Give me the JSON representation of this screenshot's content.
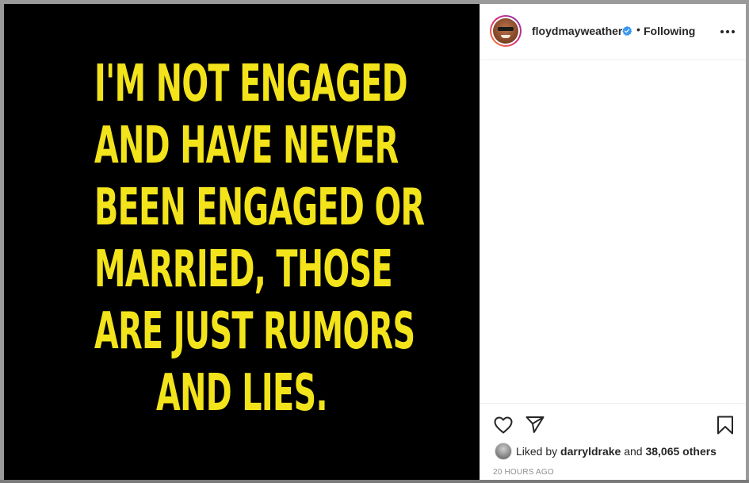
{
  "post": {
    "quote_lines": [
      "I'M NOT ENGAGED",
      "AND HAVE NEVER",
      "BEEN ENGAGED OR",
      "MARRIED, THOSE",
      "ARE JUST RUMORS",
      "AND LIES."
    ],
    "quote_color": "#f2e31b",
    "background_color": "#000000"
  },
  "header": {
    "username": "floydmayweather",
    "verified_icon": "verified-badge-icon",
    "separator": "•",
    "follow_status": "Following",
    "more_icon": "more-options-icon"
  },
  "actions": {
    "like_icon": "heart-icon",
    "share_icon": "paper-plane-icon",
    "save_icon": "bookmark-icon"
  },
  "likes": {
    "prefix": "Liked by",
    "user": "darryldrake",
    "connector": "and",
    "others": "38,065 others"
  },
  "timestamp": "20 HOURS AGO",
  "colors": {
    "verified_blue": "#3897f0",
    "text": "#262626",
    "muted": "#8e8e8e"
  }
}
